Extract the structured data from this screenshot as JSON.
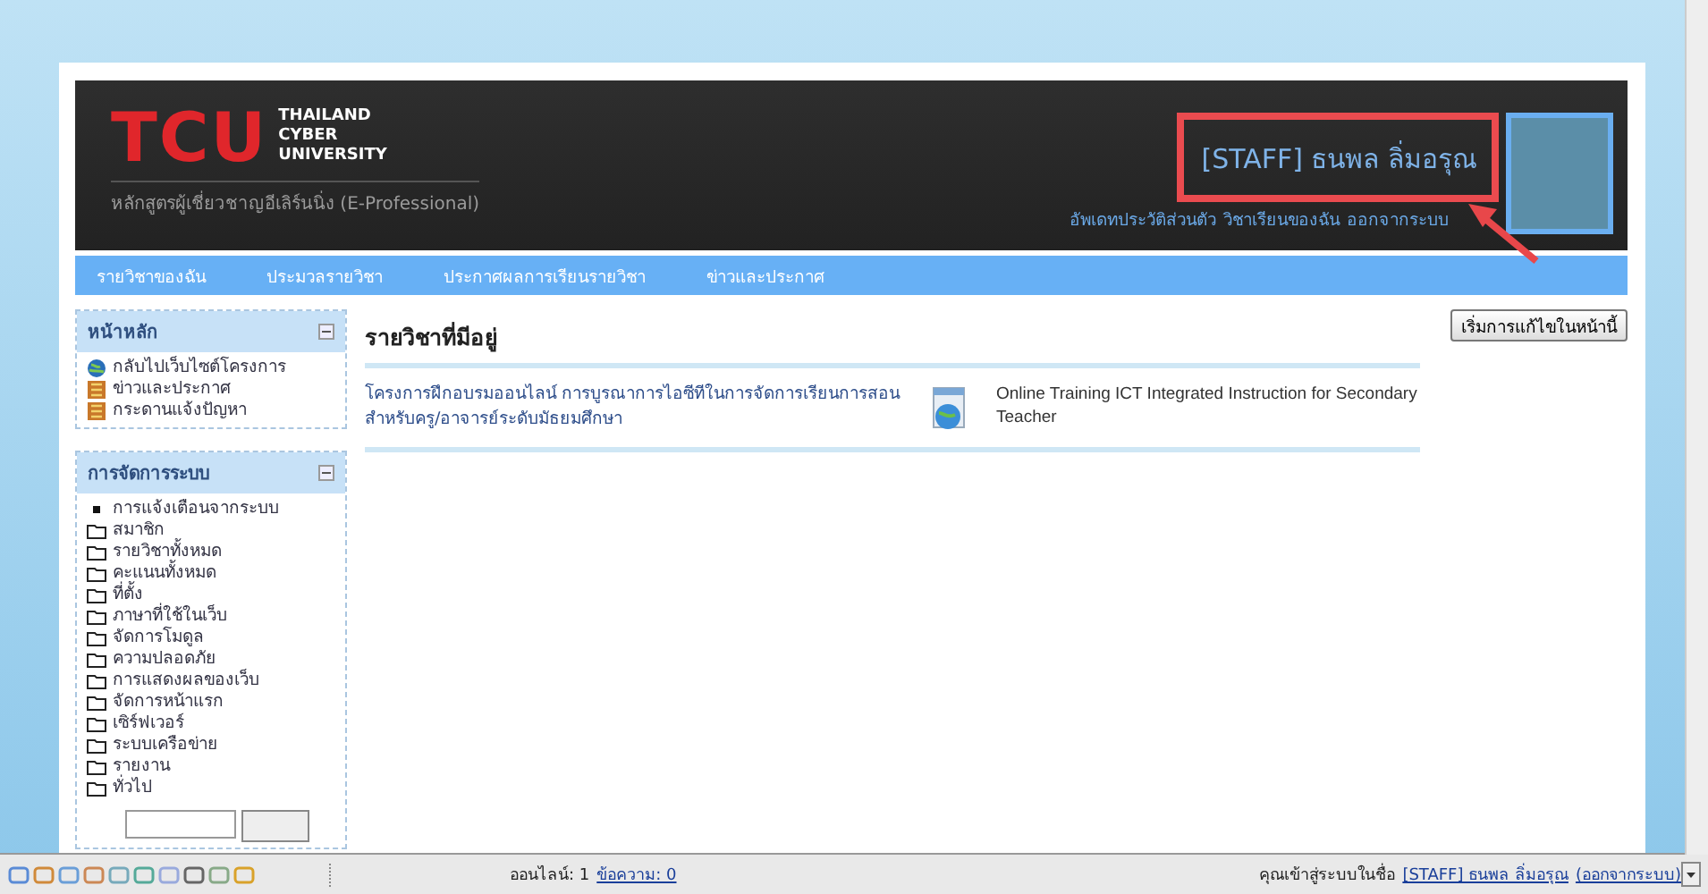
{
  "header": {
    "logo_letters": "TCU",
    "logo_words": [
      "THAILAND",
      "CYBER",
      "UNIVERSITY"
    ],
    "tagline": "หลักสูตรผู้เชี่ยวชาญอีเลิร์นนิ่ง (E-Professional)",
    "user_name": "[STAFF] ธนพล ลิ่มอรุณ",
    "user_links": [
      "อัพเดทประวัติส่วนตัว",
      "วิชาเรียนของฉัน",
      "ออกจากระบบ"
    ]
  },
  "nav": [
    "รายวิชาของฉัน",
    "ประมวลรายวิชา",
    "ประกาศผลการเรียนรายวิชา",
    "ข่าวและประกาศ"
  ],
  "sidebar": [
    {
      "title": "หน้าหลัก",
      "items": [
        {
          "kind": "globe",
          "label": "กลับไปเว็บไซต์โครงการ"
        },
        {
          "kind": "board",
          "label": "ข่าวและประกาศ"
        },
        {
          "kind": "board",
          "label": "กระดานแจ้งปัญหา"
        }
      ]
    },
    {
      "title": "การจัดการระบบ",
      "items": [
        {
          "kind": "bullet",
          "label": "การแจ้งเตือนจากระบบ"
        },
        {
          "kind": "folder",
          "label": "สมาชิก"
        },
        {
          "kind": "folder",
          "label": "รายวิชาทั้งหมด"
        },
        {
          "kind": "folder",
          "label": "คะแนนทั้งหมด"
        },
        {
          "kind": "folder",
          "label": "ที่ตั้ง"
        },
        {
          "kind": "folder",
          "label": "ภาษาที่ใช้ในเว็บ"
        },
        {
          "kind": "folder",
          "label": "จัดการโมดูล"
        },
        {
          "kind": "folder",
          "label": "ความปลอดภัย"
        },
        {
          "kind": "folder",
          "label": "การแสดงผลของเว็บ"
        },
        {
          "kind": "folder",
          "label": "จัดการหน้าแรก"
        },
        {
          "kind": "folder",
          "label": "เซิร์ฟเวอร์"
        },
        {
          "kind": "folder",
          "label": "ระบบเครือข่าย"
        },
        {
          "kind": "folder",
          "label": "รายงาน"
        },
        {
          "kind": "folder",
          "label": "ทั่วไป"
        }
      ],
      "search": true
    }
  ],
  "main": {
    "title": "รายวิชาที่มีอยู่",
    "courses": [
      {
        "name": "โครงการฝึกอบรมออนไลน์ การบูรณาการไอซีทีในการจัดการเรียนการสอนสำหรับครู/อาจารย์ระดับมัธยมศึกษา",
        "summary": "Online Training ICT Integrated Instruction for Secondary Teacher"
      }
    ],
    "edit_button": "เริ่มการแก้ไขในหน้านี้"
  },
  "status_bar": {
    "online": "ออนไลน์: 1",
    "messages": "ข้อความ: 0",
    "login_prefix": "คุณเข้าสู่ระบบในชื่อ",
    "login_user": "[STAFF] ธนพล ลิ่มอรุณ",
    "logout": "(ออกจากระบบ)"
  }
}
